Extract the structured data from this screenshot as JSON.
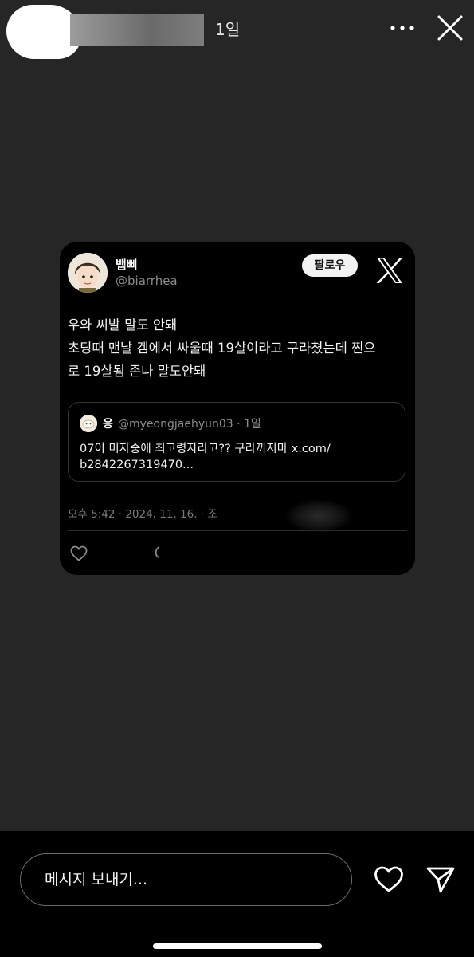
{
  "story": {
    "time_ago": "1일",
    "icons": {
      "more": "more-horizontal-icon",
      "close": "close-icon"
    }
  },
  "tweet": {
    "display_name": "뱁삐",
    "handle": "@biarrhea",
    "follow_label": "팔로우",
    "body_lines": [
      "우와 씨발 말도 안돼",
      "초딩때 맨날 겜에서 싸울때 19살이라고 구라쳤는데 찐으",
      "로 19살됨 존나 말도안돼"
    ],
    "quote": {
      "display_name": "응",
      "handle_time": "@myeongjaehyun03 · 1일",
      "text_lines": [
        "07이 미자중에 최고령자라고?? 구라까지마 x.com/",
        "b2842267319470..."
      ]
    },
    "meta": "오후 5:42 · 2024. 11. 16. · 조",
    "icons": {
      "logo": "x-logo-icon",
      "like": "heart-outline-icon",
      "reply": "reply-icon"
    }
  },
  "bottom": {
    "message_placeholder": "메시지 보내기...",
    "icons": {
      "like": "heart-icon",
      "send": "send-icon"
    }
  },
  "colors": {
    "story_background": "#262626",
    "card_background": "#000000",
    "secondary_text": "#8b8b8b"
  }
}
